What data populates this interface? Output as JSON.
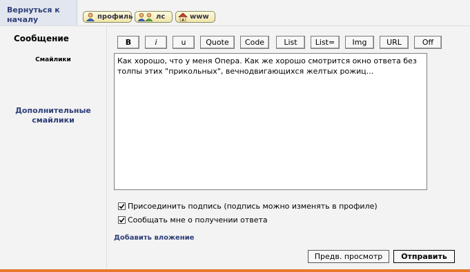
{
  "header": {
    "back_link": "Вернуться к началу",
    "profile_button": "профиль",
    "pm_button": "лс",
    "www_button": "www"
  },
  "form": {
    "message_label": "Сообщение",
    "smilies_label": "Смайлики",
    "more_smilies_label": "Дополнительные смайлики",
    "format_buttons": [
      "B",
      "i",
      "u",
      "Quote",
      "Code",
      "List",
      "List=",
      "Img",
      "URL",
      "Off"
    ],
    "message_text": "Как хорошо, что у меня Опера. Как же хорошо смотрится окно ответа без толпы этих \"прикольных\", вечнодвигающихся желтых рожиц...",
    "attach_signature_label": "Присоединить подпись (подпись можно изменять в профиле)",
    "attach_signature_checked": true,
    "notify_label": "Сообщать мне о получении ответа",
    "notify_checked": true,
    "add_attachment_label": "Добавить вложение",
    "preview_button": "Предв. просмотр",
    "submit_button": "Отправить"
  },
  "colors": {
    "link": "#2d3d78",
    "accent_rule": "#e8782c",
    "panel_bg": "#f3f3f3"
  },
  "icons": {
    "profile": "user-icon",
    "pm": "users-icon",
    "www": "home-icon"
  }
}
